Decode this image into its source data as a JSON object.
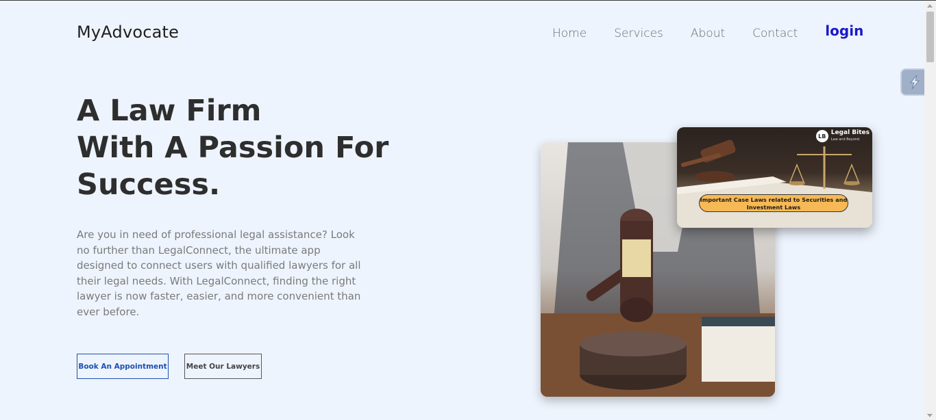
{
  "header": {
    "brand": "MyAdvocate",
    "nav": [
      "Home",
      "Services",
      "About",
      "Contact"
    ],
    "login": "login"
  },
  "hero": {
    "headline": [
      "A Law Firm",
      "With A Passion For",
      "Success."
    ],
    "description": "Are you in need of professional legal assistance? Look no further than LegalConnect, the ultimate app designed to connect users with qualified lawyers for all their legal needs. With LegalConnect, finding the right lawyer is now faster, easier, and more convenient than ever before.",
    "buttons": {
      "book": "Book An Appointment",
      "lawyers": "Meet Our Lawyers"
    }
  },
  "images": {
    "secondary": {
      "logo_mark": "LB",
      "logo_title": "Legal Bites",
      "logo_sub": "Law and Beyond",
      "banner": "Important Case Laws related to Securities and Investment Laws"
    }
  },
  "icons": {
    "gavel": "gavel-icon",
    "widget": "extension-widget-icon"
  },
  "colors": {
    "background": "#eef4fd",
    "login": "#1a1ac8",
    "primary_button": "#1b4fb0",
    "banner": "#f7b955"
  }
}
